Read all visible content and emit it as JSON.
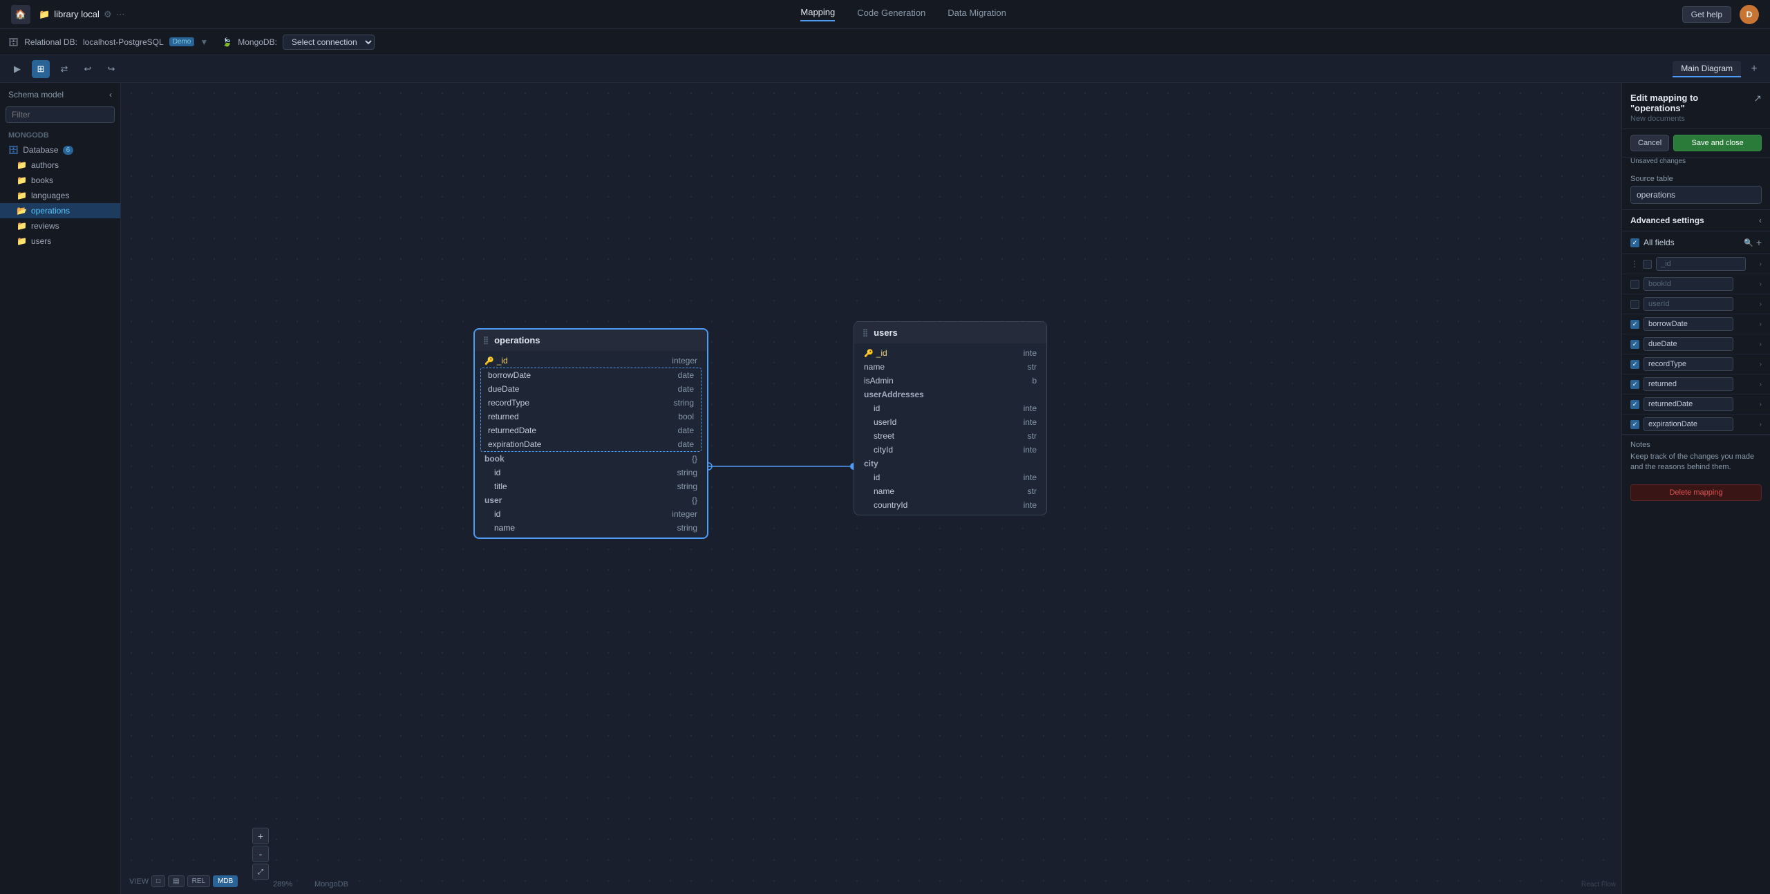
{
  "topbar": {
    "home_icon": "🏠",
    "app_name": "library local",
    "settings_icon": "⚙",
    "dots_icon": "⋯",
    "tabs": [
      {
        "label": "Mapping",
        "active": true
      },
      {
        "label": "Code Generation",
        "active": false
      },
      {
        "label": "Data Migration",
        "active": false
      }
    ],
    "get_help_label": "Get help",
    "avatar_initials": "D"
  },
  "dbbar": {
    "relational_label": "Relational DB:",
    "relational_connection": "localhost-PostgreSQL",
    "relational_badge": "Demo",
    "mongo_label": "MongoDB:",
    "mongo_connection": "Select connection"
  },
  "toolbar": {
    "tabs": [
      {
        "label": "Main Diagram"
      }
    ],
    "add_tab": "+"
  },
  "sidebar": {
    "title": "Schema model",
    "filter_placeholder": "Filter",
    "db_label": "MongoDB",
    "database_item": "Database",
    "database_count": "6",
    "items": [
      {
        "label": "authors",
        "active": false
      },
      {
        "label": "books",
        "active": false
      },
      {
        "label": "languages",
        "active": false
      },
      {
        "label": "operations",
        "active": true
      },
      {
        "label": "reviews",
        "active": false
      },
      {
        "label": "users",
        "active": false
      }
    ]
  },
  "canvas": {
    "operations_table": {
      "title": "operations",
      "fields": [
        {
          "name": "_id",
          "type": "integer",
          "is_key": true,
          "selected": false
        },
        {
          "name": "borrowDate",
          "type": "date",
          "selected": true
        },
        {
          "name": "dueDate",
          "type": "date",
          "selected": true
        },
        {
          "name": "recordType",
          "type": "string",
          "selected": true
        },
        {
          "name": "returned",
          "type": "bool",
          "selected": true
        },
        {
          "name": "returnedDate",
          "type": "date",
          "selected": true
        },
        {
          "name": "expirationDate",
          "type": "date",
          "selected": true
        },
        {
          "name": "book",
          "type": "{}",
          "selected": false
        },
        {
          "name": "id",
          "type": "string",
          "nested": true,
          "selected": false
        },
        {
          "name": "title",
          "type": "string",
          "nested": true,
          "selected": false
        },
        {
          "name": "user",
          "type": "{}",
          "selected": false
        },
        {
          "name": "id",
          "type": "integer",
          "nested": true,
          "selected": false
        },
        {
          "name": "name",
          "type": "string",
          "nested": true,
          "selected": false
        }
      ]
    },
    "users_table": {
      "title": "users",
      "fields": [
        {
          "name": "_id",
          "type": "inte",
          "is_key": true
        },
        {
          "name": "name",
          "type": "str"
        },
        {
          "name": "isAdmin",
          "type": "b"
        },
        {
          "name": "userAddresses",
          "type": ""
        },
        {
          "name": "id",
          "type": "inte",
          "nested": true
        },
        {
          "name": "userId",
          "type": "inte",
          "nested": true
        },
        {
          "name": "street",
          "type": "str",
          "nested": true
        },
        {
          "name": "cityId",
          "type": "inte",
          "nested": true
        },
        {
          "name": "city",
          "type": ""
        },
        {
          "name": "id",
          "type": "inte",
          "nested": true
        },
        {
          "name": "name",
          "type": "str",
          "nested": true
        },
        {
          "name": "countryId",
          "type": "inte",
          "nested": true
        }
      ]
    }
  },
  "right_panel": {
    "title": "Edit mapping to \"operations\"",
    "subtitle": "New documents",
    "cancel_label": "Cancel",
    "save_close_label": "Save and close",
    "unsaved_label": "Unsaved changes",
    "source_table_label": "Source table",
    "source_table_value": "operations",
    "advanced_settings_label": "Advanced settings",
    "all_fields_label": "All fields",
    "fields": [
      {
        "name": "_id",
        "checked": false,
        "three_dots": true
      },
      {
        "name": "bookId",
        "checked": false
      },
      {
        "name": "userId",
        "checked": false
      },
      {
        "name": "borrowDate",
        "checked": true
      },
      {
        "name": "dueDate",
        "checked": true
      },
      {
        "name": "recordType",
        "checked": true
      },
      {
        "name": "returned",
        "checked": true
      },
      {
        "name": "returnedDate",
        "checked": true
      },
      {
        "name": "expirationDate",
        "checked": true
      }
    ],
    "notes_label": "Notes",
    "notes_text": "Keep track of the changes you made and the reasons behind them.",
    "delete_mapping_label": "Delete mapping"
  },
  "bottombar": {
    "view_label": "VIEW",
    "view_buttons": [
      {
        "label": "□",
        "active": false
      },
      {
        "label": "▤",
        "active": false
      },
      {
        "label": "REL",
        "active": false
      },
      {
        "label": "MDB",
        "active": true
      }
    ],
    "zoom_plus": "+",
    "zoom_minus": "-",
    "zoom_value": "289%",
    "db_label": "MongoDB"
  }
}
